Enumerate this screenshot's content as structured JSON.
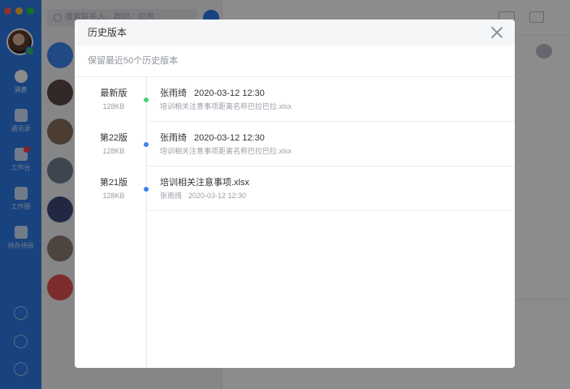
{
  "background": {
    "search_placeholder": "搜索联系人、群组、应用",
    "nav": [
      {
        "label": "消息",
        "icon": "chat-bubble-icon"
      },
      {
        "label": "通讯录",
        "icon": "person-icon"
      },
      {
        "label": "工作台",
        "icon": "grid-apps-icon"
      },
      {
        "label": "工作圈",
        "icon": "compass-icon"
      },
      {
        "label": "待办待阅",
        "icon": "document-list-icon"
      }
    ]
  },
  "dialog": {
    "title": "历史版本",
    "subtitle": "保留最近50个历史版本",
    "versions": [
      {
        "name": "最新版",
        "size": "128KB",
        "author": "张雨绮",
        "time": "2020-03-12 12:30",
        "file": "培训相关注意事项距离名称巴拉巴拉.xlsx",
        "dot_color": "#4cd07d"
      },
      {
        "name": "第22版",
        "size": "128KB",
        "author": "张雨绮",
        "time": "2020-03-12 12:30",
        "file": "培训相关注意事项距离名称巴拉巴拉.xlsx",
        "dot_color": "#3b82f0"
      },
      {
        "name": "第21版",
        "size": "128KB",
        "file_title": "培训相关注意事项.xlsx",
        "author": "张雨绮",
        "time": "2020-03-12 12:30",
        "dot_color": "#3b82f0"
      }
    ]
  },
  "colors": {
    "sidebar": "#2f7be8",
    "overlay": "rgba(0,0,0,0.45)",
    "dot_latest": "#4cd07d",
    "dot_other": "#3b82f0"
  }
}
